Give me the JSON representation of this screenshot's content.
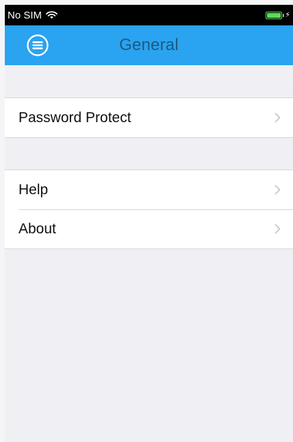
{
  "status_bar": {
    "carrier": "No SIM",
    "wifi_icon": "wifi-icon",
    "battery_icon": "battery-charging-icon",
    "battery_level": 1.0,
    "battery_color": "#5dd65a"
  },
  "nav_bar": {
    "title": "General",
    "menu_icon": "menu-icon",
    "background": "#2aa3f0",
    "title_color": "#1c5b82"
  },
  "groups": [
    {
      "items": [
        {
          "label": "Password Protect",
          "accessory": "chevron-right-icon"
        }
      ]
    },
    {
      "items": [
        {
          "label": "Help",
          "accessory": "chevron-right-icon"
        },
        {
          "label": "About",
          "accessory": "chevron-right-icon"
        }
      ]
    }
  ]
}
